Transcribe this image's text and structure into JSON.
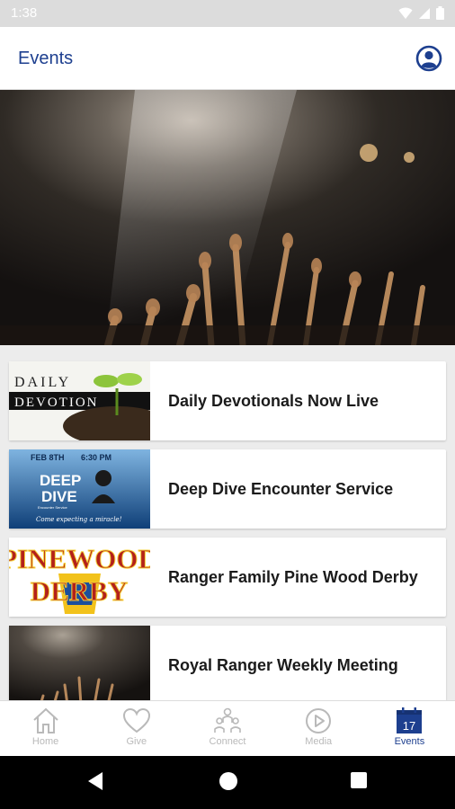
{
  "status": {
    "time": "1:38"
  },
  "header": {
    "title": "Events"
  },
  "events": [
    {
      "title": "Daily Devotionals Now Live",
      "thumb_text": [
        "DAILY",
        "DEVOTION"
      ]
    },
    {
      "title": "Deep Dive Encounter Service",
      "thumb_text": [
        "FEB 8TH",
        "6:30 PM",
        "DEEP",
        "DIVE",
        "Encounter Service",
        "Come expecting a miracle!"
      ]
    },
    {
      "title": "Ranger Family Pine Wood Derby",
      "thumb_text": [
        "PINEWOOD",
        "DERBY"
      ]
    },
    {
      "title": "Royal Ranger Weekly Meeting"
    }
  ],
  "tabs": [
    {
      "label": "Home",
      "icon": "home-icon"
    },
    {
      "label": "Give",
      "icon": "heart-icon"
    },
    {
      "label": "Connect",
      "icon": "people-icon"
    },
    {
      "label": "Media",
      "icon": "play-icon"
    },
    {
      "label": "Events",
      "icon": "calendar-icon",
      "badge": "17",
      "active": true
    }
  ],
  "colors": {
    "accent": "#1d3f8f",
    "inactive": "#b9b9b9"
  }
}
